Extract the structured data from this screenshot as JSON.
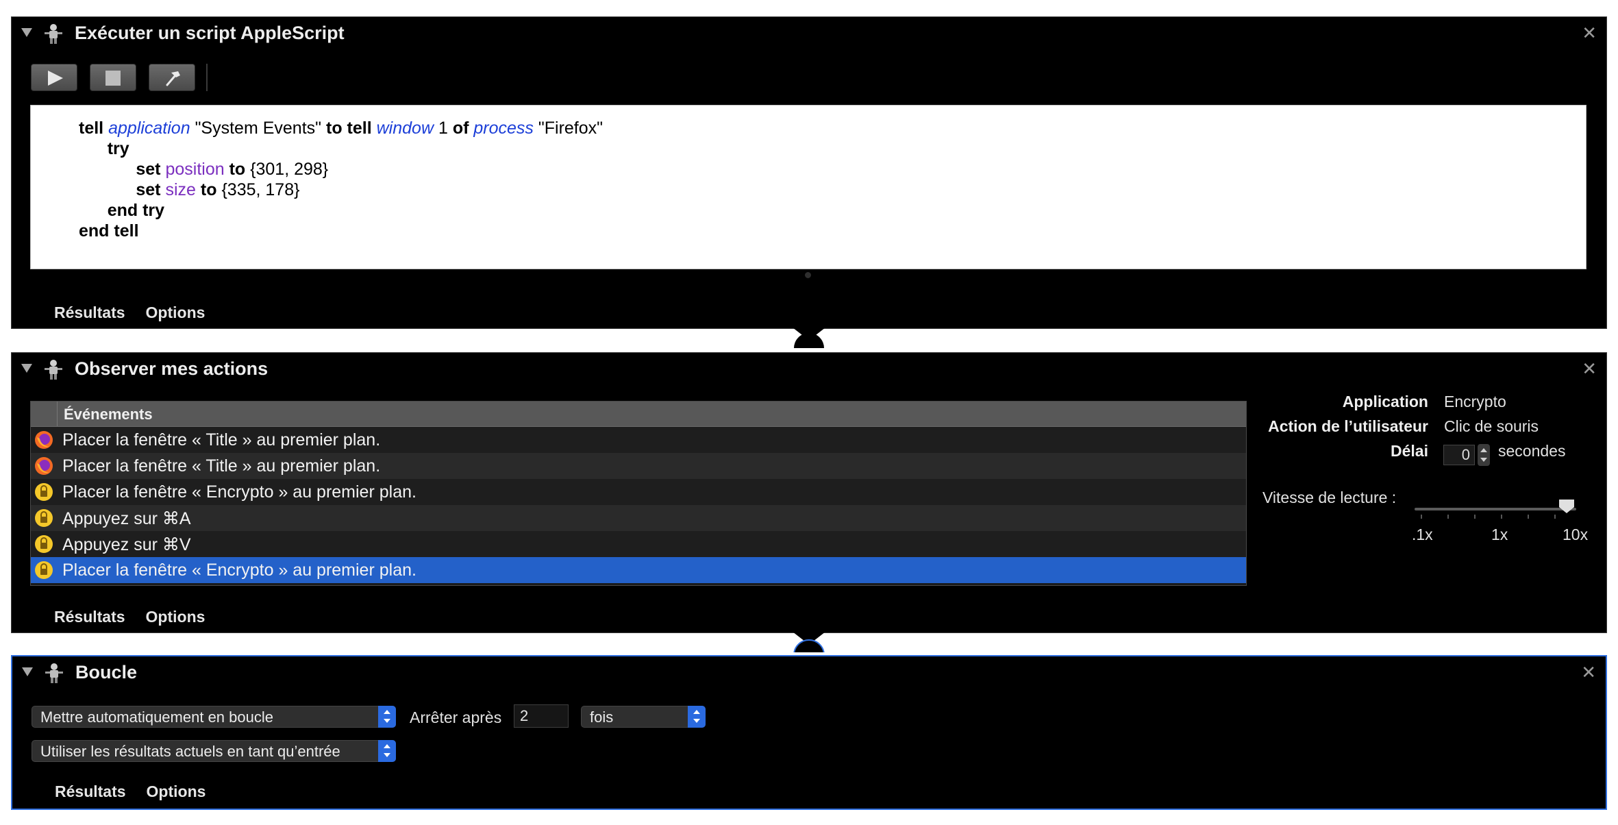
{
  "panel1": {
    "title": "Exécuter un script AppleScript",
    "code": {
      "l1": [
        "tell",
        "application",
        "\"System Events\"",
        "to tell",
        "window",
        "1",
        "of",
        "process",
        "\"Firefox\""
      ],
      "l2": [
        "try"
      ],
      "l3": [
        "set",
        "position",
        "to",
        "{301, 298}"
      ],
      "l4": [
        "set",
        "size",
        "to",
        "{335, 178}"
      ],
      "l5": [
        "end try"
      ],
      "l6": [
        "end tell"
      ]
    },
    "tabs": [
      "Résultats",
      "Options"
    ]
  },
  "panel2": {
    "title": "Observer mes actions",
    "column_header": "Événements",
    "events": [
      {
        "icon": "firefox-icon",
        "text": "Placer la fenêtre « Title » au premier plan."
      },
      {
        "icon": "firefox-icon",
        "text": "Placer la fenêtre « Title » au premier plan."
      },
      {
        "icon": "encrypto-icon",
        "text": "Placer la fenêtre « Encrypto » au premier plan."
      },
      {
        "icon": "encrypto-icon",
        "text": "Appuyez sur ⌘A"
      },
      {
        "icon": "encrypto-icon",
        "text": "Appuyez sur ⌘V"
      },
      {
        "icon": "encrypto-icon",
        "text": "Placer la fenêtre « Encrypto » au premier plan.",
        "selected": true
      }
    ],
    "info": {
      "application_label": "Application",
      "application_value": "Encrypto",
      "user_action_label": "Action de l’utilisateur",
      "user_action_value": "Clic de souris",
      "delay_label": "Délai",
      "delay_value": "0",
      "delay_unit": "secondes",
      "speed_label": "Vitesse de lecture :",
      "speed_ticks": [
        ".1x",
        "1x",
        "10x"
      ],
      "speed_value": "10x"
    },
    "tabs": [
      "Résultats",
      "Options"
    ]
  },
  "panel3": {
    "title": "Boucle",
    "loop_mode": "Mettre automatiquement en boucle",
    "stop_after_label": "Arrêter après",
    "stop_after_value": "2",
    "unit": "fois",
    "input_mode": "Utiliser les résultats actuels en tant qu’entrée",
    "tabs": [
      "Résultats",
      "Options"
    ]
  },
  "colors": {
    "selection": "#2461c9",
    "selected_border": "#2f6fdf",
    "keyword_class": "#1c3fd8",
    "keyword_property": "#7b2fbf"
  }
}
